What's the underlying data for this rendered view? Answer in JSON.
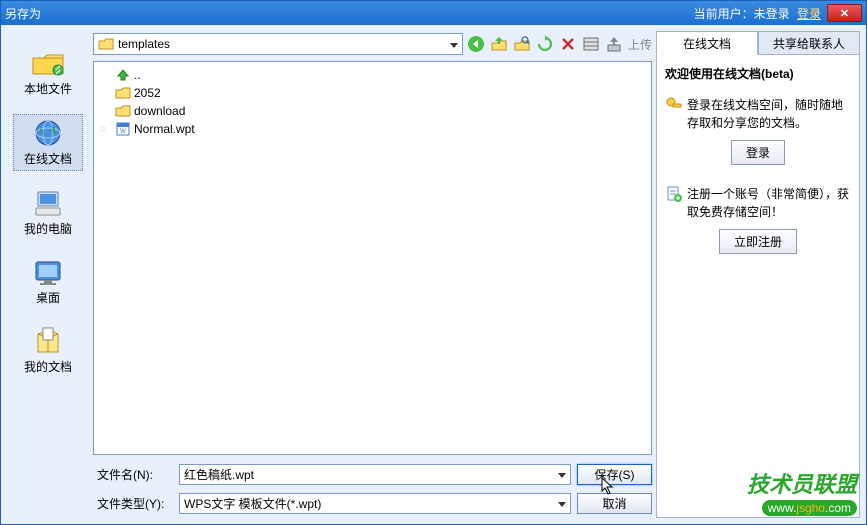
{
  "window": {
    "title": "另存为"
  },
  "titlebar": {
    "user_label": "当前用户：未登录",
    "login_link": "登录"
  },
  "sidebar": {
    "items": [
      {
        "label": "本地文件",
        "icon": "folder-local"
      },
      {
        "label": "在线文档",
        "icon": "globe",
        "selected": true
      },
      {
        "label": "我的电脑",
        "icon": "computer"
      },
      {
        "label": "桌面",
        "icon": "desktop"
      },
      {
        "label": "我的文档",
        "icon": "documents"
      }
    ]
  },
  "path": {
    "current": "templates"
  },
  "navbar": {
    "upload_label": "上传"
  },
  "files": [
    {
      "name": "..",
      "icon": "up",
      "star": false
    },
    {
      "name": "2052",
      "icon": "folder",
      "star": false
    },
    {
      "name": "download",
      "icon": "folder",
      "star": false
    },
    {
      "name": "Normal.wpt",
      "icon": "wpt",
      "star": true
    }
  ],
  "form": {
    "filename_label": "文件名(N):",
    "filename_value": "红色稿纸.wpt",
    "filetype_label": "文件类型(Y):",
    "filetype_value": "WPS文字 模板文件(*.wpt)",
    "save_label": "保存(S)",
    "cancel_label": "取消"
  },
  "right": {
    "tabs": [
      {
        "label": "在线文档",
        "active": true
      },
      {
        "label": "共享给联系人",
        "active": false
      }
    ],
    "heading": "欢迎使用在线文档(beta)",
    "block1": "登录在线文档空间，随时随地存取和分享您的文档。",
    "btn1": "登录",
    "block2": "注册一个账号（非常简便），获取免费存储空间！",
    "btn2": "立即注册"
  },
  "watermark": {
    "line1": "技术员联盟",
    "line2_a": "www.",
    "line2_b": "jsgho",
    "line2_c": ".com"
  }
}
